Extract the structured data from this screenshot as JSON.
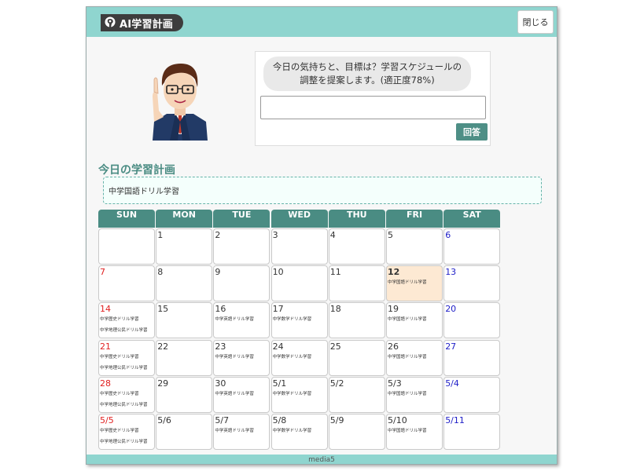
{
  "header": {
    "logo_text": "AI学習計画",
    "close_label": "閉じる"
  },
  "chat": {
    "question_line1": "今日の気持ちと、目標は？学習スケジュールの",
    "question_line2": "調整を提案します。(適正度78%)",
    "answer_value": "",
    "answer_button": "回答"
  },
  "plan": {
    "title": "今日の学習計画",
    "today_item": "中学国語ドリル学習"
  },
  "calendar": {
    "weekdays": [
      "SUN",
      "MON",
      "TUE",
      "WED",
      "THU",
      "FRI",
      "SAT"
    ],
    "weeks": [
      [
        {
          "day": "",
          "events": []
        },
        {
          "day": "1",
          "events": []
        },
        {
          "day": "2",
          "events": []
        },
        {
          "day": "3",
          "events": []
        },
        {
          "day": "4",
          "events": []
        },
        {
          "day": "5",
          "events": []
        },
        {
          "day": "6",
          "events": []
        }
      ],
      [
        {
          "day": "7",
          "events": []
        },
        {
          "day": "8",
          "events": []
        },
        {
          "day": "9",
          "events": []
        },
        {
          "day": "10",
          "events": []
        },
        {
          "day": "11",
          "events": []
        },
        {
          "day": "12",
          "events": [
            "中学国語ドリル学習"
          ],
          "today": true
        },
        {
          "day": "13",
          "events": []
        }
      ],
      [
        {
          "day": "14",
          "events": [
            "中学歴史ドリル学習",
            "中学地理公民ドリル学習"
          ]
        },
        {
          "day": "15",
          "events": []
        },
        {
          "day": "16",
          "events": [
            "中学英語ドリル学習"
          ]
        },
        {
          "day": "17",
          "events": [
            "中学数学ドリル学習"
          ]
        },
        {
          "day": "18",
          "events": []
        },
        {
          "day": "19",
          "events": [
            "中学国語ドリル学習"
          ]
        },
        {
          "day": "20",
          "events": []
        }
      ],
      [
        {
          "day": "21",
          "events": [
            "中学歴史ドリル学習",
            "中学地理公民ドリル学習"
          ]
        },
        {
          "day": "22",
          "events": []
        },
        {
          "day": "23",
          "events": [
            "中学英語ドリル学習"
          ]
        },
        {
          "day": "24",
          "events": [
            "中学数学ドリル学習"
          ]
        },
        {
          "day": "25",
          "events": []
        },
        {
          "day": "26",
          "events": [
            "中学国語ドリル学習"
          ]
        },
        {
          "day": "27",
          "events": []
        }
      ],
      [
        {
          "day": "28",
          "events": [
            "中学歴史ドリル学習",
            "中学地理公民ドリル学習"
          ]
        },
        {
          "day": "29",
          "events": []
        },
        {
          "day": "30",
          "events": [
            "中学英語ドリル学習"
          ]
        },
        {
          "day": "5/1",
          "events": [
            "中学数学ドリル学習"
          ]
        },
        {
          "day": "5/2",
          "events": []
        },
        {
          "day": "5/3",
          "events": [
            "中学国語ドリル学習"
          ]
        },
        {
          "day": "5/4",
          "events": []
        }
      ],
      [
        {
          "day": "5/5",
          "events": [
            "中学歴史ドリル学習",
            "中学地理公民ドリル学習"
          ]
        },
        {
          "day": "5/6",
          "events": []
        },
        {
          "day": "5/7",
          "events": [
            "中学英語ドリル学習"
          ]
        },
        {
          "day": "5/8",
          "events": [
            "中学数学ドリル学習"
          ]
        },
        {
          "day": "5/9",
          "events": []
        },
        {
          "day": "5/10",
          "events": [
            "中学国語ドリル学習"
          ]
        },
        {
          "day": "5/11",
          "events": []
        }
      ]
    ]
  },
  "footer": {
    "text": "media5"
  },
  "colors": {
    "header_bg": "#8fd5cf",
    "accent": "#4a8c83",
    "today_bg": "#fde9d3",
    "sunday": "#e02020",
    "saturday": "#2020c8"
  }
}
